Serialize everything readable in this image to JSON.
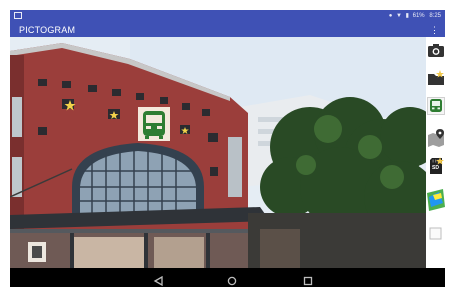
{
  "status_bar": {
    "battery_percent": "61%",
    "time": "8:25",
    "icons": [
      "notification-icon",
      "location-icon",
      "wifi-icon",
      "signal-icon",
      "battery-icon"
    ]
  },
  "app_bar": {
    "title": "PICTOGRAM",
    "overflow_icon": "more-vert-icon"
  },
  "side_tools": [
    {
      "name": "camera-icon"
    },
    {
      "name": "folder-add-icon"
    },
    {
      "name": "bus-pictogram-icon",
      "selected": true
    },
    {
      "name": "map-pin-icon"
    },
    {
      "name": "sd-card-icon",
      "label": "SD"
    },
    {
      "name": "map-icon"
    },
    {
      "name": "checkbox-icon"
    }
  ],
  "nav_bar": {
    "icons": [
      "back-icon",
      "home-icon",
      "recent-apps-icon"
    ]
  },
  "colors": {
    "primary": "#3f51b5",
    "brick": "#9b3e3b",
    "pictogram": "#2e7d32"
  }
}
